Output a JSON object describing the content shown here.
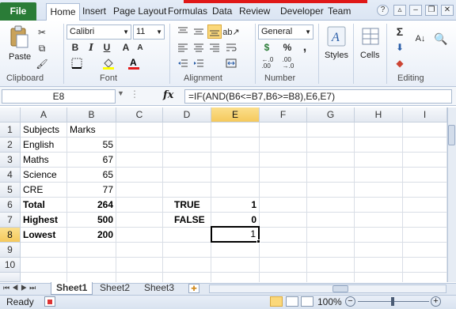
{
  "ribbon": {
    "tabs": [
      "File",
      "Home",
      "Insert",
      "Page Layout",
      "Formulas",
      "Data",
      "Review",
      "Developer",
      "Team"
    ],
    "clipboard": {
      "paste_label": "Paste",
      "group_label": "Clipboard"
    },
    "font": {
      "name": "Calibri",
      "size": "11",
      "bold": "B",
      "italic": "I",
      "underline": "U",
      "group_label": "Font"
    },
    "alignment": {
      "group_label": "Alignment"
    },
    "number": {
      "format": "General",
      "currency": "$",
      "percent": "%",
      "comma": ",",
      "inc_dec": "+.0\n.00",
      "group_label": "Number"
    },
    "styles_label": "Styles",
    "cells_label": "Cells",
    "editing": {
      "sum": "Σ",
      "group_label": "Editing"
    }
  },
  "formula_bar": {
    "name_box": "E8",
    "fx": "fx",
    "formula": "=IF(AND(B6<=B7,B6>=B8),E6,E7)"
  },
  "columns": [
    "A",
    "B",
    "C",
    "D",
    "E",
    "F",
    "G",
    "H",
    "I"
  ],
  "rows": [
    "1",
    "2",
    "3",
    "4",
    "5",
    "6",
    "7",
    "8",
    "9",
    "10"
  ],
  "cells": {
    "A1": "Subjects",
    "B1": "Marks",
    "A2": "English",
    "B2": "55",
    "A3": "Maths",
    "B3": "67",
    "A4": "Science",
    "B4": "65",
    "A5": "CRE",
    "B5": "77",
    "A6": "Total",
    "B6": "264",
    "D6": "TRUE",
    "E6": "1",
    "A7": "Highest",
    "B7": "500",
    "D7": "FALSE",
    "E7": "0",
    "A8": "Lowest",
    "B8": "200",
    "E8": "1"
  },
  "sheets": [
    "Sheet1",
    "Sheet2",
    "Sheet3"
  ],
  "status": {
    "mode": "Ready",
    "zoom": "100%"
  },
  "colors": {
    "file_tab": "#2a7c37",
    "selection": "#f5c95c"
  }
}
